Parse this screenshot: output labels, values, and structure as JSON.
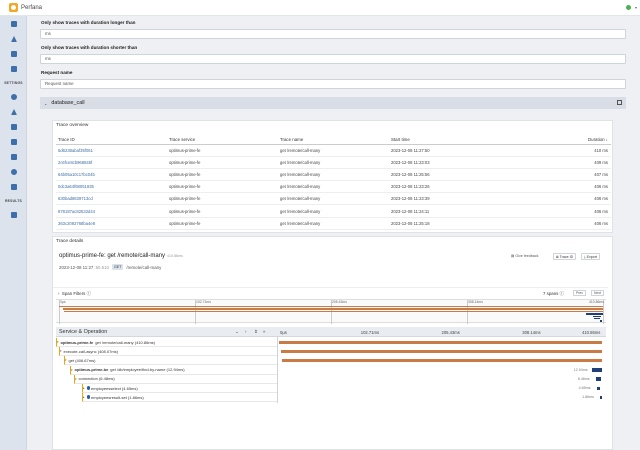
{
  "app": {
    "name": "Perfana"
  },
  "sidebar": {
    "settings_label": "SETTINGS",
    "results_label": "RESULTS",
    "icons": [
      "home-icon",
      "send-icon",
      "document-icon",
      "library-icon",
      "settings-gear-icon",
      "paper-plane-icon",
      "chart-line-icon",
      "checklist-icon",
      "file-icon",
      "target-icon",
      "link-icon",
      "bar-chart-icon"
    ]
  },
  "filters": {
    "duration_longer_label": "Only show traces with duration longer than",
    "duration_longer_value": "ms",
    "duration_shorter_label": "Only show traces with duration shorter than",
    "duration_shorter_value": "ms",
    "request_name_label": "Request name",
    "request_name_placeholder": "Request name"
  },
  "accordion": {
    "title": "database_call"
  },
  "trace_overview": {
    "title": "Trace overview",
    "columns": [
      "Trace ID",
      "Trace service",
      "Trace name",
      "Start time",
      "Duration"
    ],
    "rows": [
      {
        "id": "5d6238abaf35f051",
        "service": "optimus-prime-fe",
        "name": "get /remote/call-many",
        "start": "2023-12-08 11:27:50",
        "duration": "410 ms"
      },
      {
        "id": "2c6fce8cb968845f",
        "service": "optimus-prime-fe",
        "name": "get /remote/call-many",
        "start": "2023-12-08 11:23:03",
        "duration": "409 ms"
      },
      {
        "id": "64b05a10c17bc04b",
        "service": "optimus-prime-fe",
        "name": "get /remote/call-many",
        "start": "2023-12-08 11:25:56",
        "duration": "407 ms"
      },
      {
        "id": "0dc3a64f68051935",
        "service": "optimus-prime-fe",
        "name": "get /remote/call-many",
        "start": "2023-12-08 11:23:26",
        "duration": "406 ms"
      },
      {
        "id": "630bad6839713cd",
        "service": "optimus-prime-fe",
        "name": "get /remote/call-many",
        "start": "2023-12-08 11:23:39",
        "duration": "406 ms"
      },
      {
        "id": "878187ac82532d44",
        "service": "optimus-prime-fe",
        "name": "get /remote/call-many",
        "start": "2023-12-08 11:24:11",
        "duration": "406 ms"
      },
      {
        "id": "363c2092768ba4e8",
        "service": "optimus-prime-fe",
        "name": "get /remote/call-many",
        "start": "2023-12-08 11:25:18",
        "duration": "406 ms"
      }
    ]
  },
  "trace_details": {
    "title": "Trace details",
    "trace_title": "optimus-prime-fe: get /remote/call-many",
    "trace_duration": "410.86ms",
    "timestamp": "2023-12-08 11:27",
    "timestamp_suffix": ":50.510",
    "method": "GET",
    "path": "/remote/call-many",
    "give_feedback": "Give feedback",
    "trace_id_btn": "Trace ID",
    "export_btn": "Export",
    "span_filters": "Span Filters",
    "span_count": "7 spans",
    "prev_btn": "Prev",
    "next_btn": "Next",
    "ticks": [
      "0μs",
      "102.71ms",
      "205.43ms",
      "308.14ms",
      "410.86ms"
    ],
    "service_operation_label": "Service & Operation",
    "spans": [
      {
        "service": "optimus-prime-fe",
        "op": "get /remote/call-many (410.86ms)",
        "start": 0,
        "duration": 410.86,
        "color": "#c97a45",
        "label": ""
      },
      {
        "service": "",
        "op": "execute-call-async (408.07ms)",
        "start": 2.7,
        "duration": 408.07,
        "color": "#c97a45",
        "label": ""
      },
      {
        "service": "",
        "op": "get (406.67ms)",
        "start": 4.1,
        "duration": 406.67,
        "color": "#c97a45",
        "label": ""
      },
      {
        "service": "optimus-prime-be",
        "op": "get /db/employee/find-by-name (12.94ms)",
        "start": 397.9,
        "duration": 12.94,
        "color": "#1f3f7a",
        "label": "12.94ms"
      },
      {
        "service": "",
        "op": "connection (6.48ms)",
        "start": 403.0,
        "duration": 6.48,
        "color": "#1f3f7a",
        "label": "6.48ms"
      },
      {
        "service": "employees",
        "op": "select (4.65ms)",
        "start": 404.0,
        "duration": 4.65,
        "color": "#1f3f7a",
        "label": "4.65ms"
      },
      {
        "service": "employees",
        "op": "result-set (1.86ms)",
        "start": 408.5,
        "duration": 1.86,
        "color": "#1f3f7a",
        "label": "1.86ms"
      }
    ],
    "total_ms": 410.86
  }
}
